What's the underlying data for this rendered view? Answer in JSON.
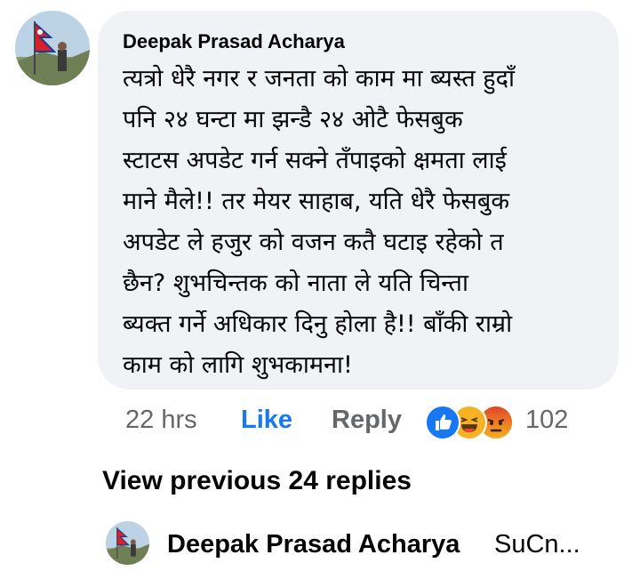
{
  "comment": {
    "author": "Deepak Prasad Acharya",
    "text": "त्यत्रो धेरै नगर र जनता को काम मा ब्यस्त हुदाँ\nपनि २४ घन्टा मा झन्डै २४ ओटै फेसबुक\nस्टाटस अपडेट गर्न सक्ने तँपाइको क्षमता लाई\nमाने मैले!! तर मेयर साहाब, यति धेरै फेसबुक\nअपडेट ले हजुर को वजन कतै घटाइ रहेको त\nछैन? शुभचिन्तक को नाता ले यति चिन्ता\nब्यक्त गर्ने अधिकार दिनु होला है!! बाँकी राम्रो\nकाम को लागि शुभकामना!",
    "time": "22 hrs",
    "like_label": "Like",
    "reply_label": "Reply",
    "reaction_icons": [
      "like-reaction-icon",
      "haha-reaction-icon",
      "angry-reaction-icon"
    ],
    "reaction_count": "102"
  },
  "view_previous": "View previous 24 replies",
  "latest_reply": {
    "author": "Deepak Prasad Acharya",
    "snippet": "SuCn..."
  },
  "colors": {
    "bubble": "#f0f2f5",
    "link_blue": "#1877f2",
    "muted": "#65676b",
    "text": "#050505"
  }
}
